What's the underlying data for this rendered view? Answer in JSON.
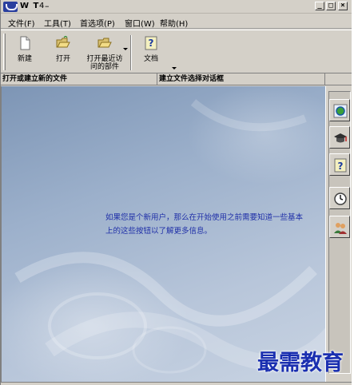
{
  "titlebar": {
    "title": "W T",
    "sep": "4",
    "dash": "–",
    "minimize": "_",
    "restore": "□",
    "close": "×"
  },
  "menu": [
    {
      "label": "文件(F)"
    },
    {
      "label": "工具(T)"
    },
    {
      "label": "首选项(P)"
    },
    {
      "label": "窗口(W)"
    },
    {
      "label": "帮助(H)"
    }
  ],
  "toolbar": {
    "new_label": "新建",
    "open_label": "打开",
    "open_recent_label_1": "打开最近访",
    "open_recent_label_2": "问的部件",
    "docs_label": "文档",
    "icons": {
      "new": "new-document-icon",
      "open": "open-folder-icon",
      "open_recent": "recent-folder-icon",
      "docs": "help-book-icon"
    }
  },
  "header": {
    "left": "打开或建立新的文件",
    "right": "建立文件选择对话框"
  },
  "main": {
    "line1": "如果您是个新用户，那么在开始使用之前需要知道一些基本",
    "line2": "上的这些按钮以了解更多信息。"
  },
  "rail": {
    "icons": [
      "globe-icon",
      "graduation-cap-icon",
      "help-question-icon",
      "clock-icon",
      "users-icon"
    ]
  },
  "watermark": "最需教育",
  "colors": {
    "chrome": "#d4d0c8",
    "text_blue": "#1f2fa8",
    "watermark_blue": "#1a2fb0"
  }
}
